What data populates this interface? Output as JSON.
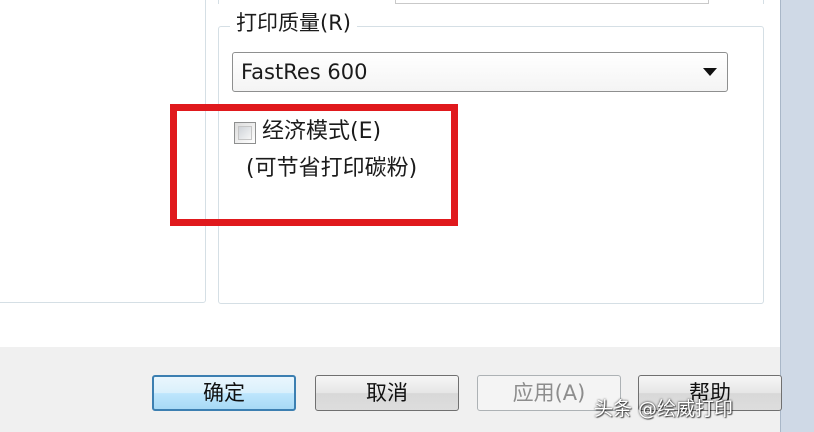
{
  "print_quality": {
    "title": "打印质量(R)",
    "selected_value": "FastRes 600"
  },
  "economy_mode": {
    "label": "经济模式(E)",
    "note": "(可节省打印碳粉)",
    "checked": false
  },
  "buttons": {
    "ok": "确定",
    "cancel": "取消",
    "apply": "应用(A)",
    "help": "帮助"
  },
  "watermark": "头条 @绘威打印",
  "colors": {
    "highlight": "#e0191d",
    "default_button_border": "#3c7fb1"
  }
}
